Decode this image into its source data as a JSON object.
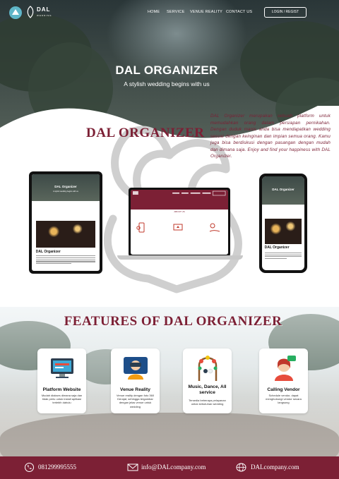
{
  "brand": {
    "name": "DAL",
    "tagline": "WEDDING"
  },
  "nav": {
    "links": [
      "HOME",
      "SERVICE",
      "VENUE REALITY",
      "CONTACT US"
    ],
    "login_label": "LOGIN / REGIST"
  },
  "hero": {
    "title": "DAL ORGANIZER",
    "subtitle": "A stylish wedding begins with us"
  },
  "about": {
    "title": "DAL ORGANIZER",
    "text": "DAL Organizer merupakan sebuah platform untuk memudahkan orang dalam persiapan pernikahan. Dengan duduk manis anda bisa mendapatkan wedding sesuai dengan keinginan dan impian semua orang. Kamu juga bisa berdiskusi dengan pasangan dengan mudah dan dimana saja. Enjoy and find your happiness with DAL Organizer."
  },
  "mockups": {
    "tablet_title": "DAL Organizer",
    "tablet_sub": "A stylish wedding begins with us",
    "tablet_heading": "DAL Organizer",
    "phone_title": "DAL Organizer",
    "phone_heading": "DAL Organizer",
    "laptop_heading": "ABOUT US"
  },
  "features": {
    "title": "FEATURES OF DAL ORGANIZER",
    "cards": [
      {
        "icon": "monitor-icon",
        "title": "Platform Website",
        "desc": "Mudah diakses dimana saja dan tidak perlu untuk install aplikasi terlebih dahulu"
      },
      {
        "icon": "virtual-tour-icon",
        "title": "Venue Reality",
        "desc": "Venue reality dengan foto 360 Derajat, sehingga tergambar dengan jelas venue untuk wedding"
      },
      {
        "icon": "wedding-arch-icon",
        "title": "Music, Dance, All service",
        "desc": "Tersedia beberapa pelayanan untuk kebutuhan wedding"
      },
      {
        "icon": "support-agent-icon",
        "title": "Calling Vendor",
        "desc": "Schedule vendor, dapat menghubungi vendor secara langsung"
      }
    ]
  },
  "footer": {
    "phone": "081299995555",
    "email": "info@DALcompany.com",
    "website": "DALcompany.com"
  },
  "colors": {
    "brand": "#7c2035",
    "white": "#ffffff"
  }
}
